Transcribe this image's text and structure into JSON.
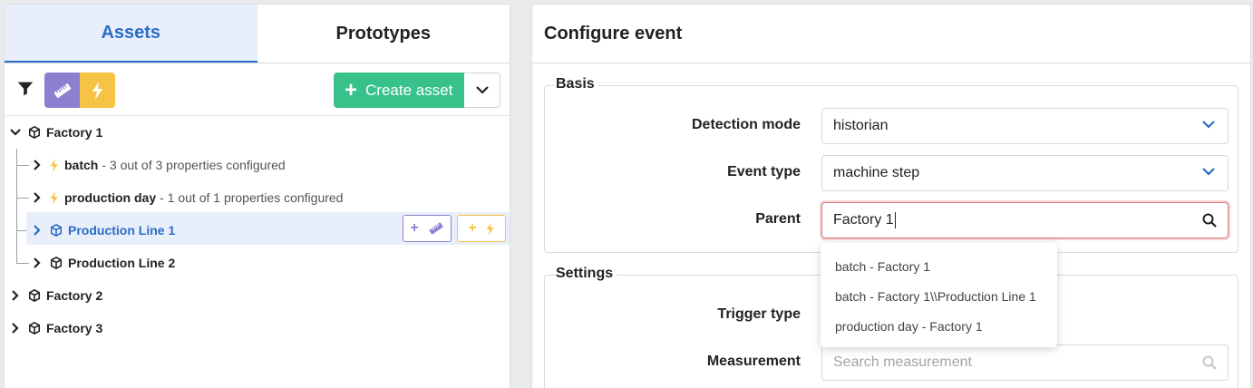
{
  "left_panel": {
    "tabs": [
      {
        "label": "Assets",
        "active": true
      },
      {
        "label": "Prototypes",
        "active": false
      }
    ],
    "toolbar": {
      "filter_icon": "filter-icon",
      "toggle_measurement_icon": "ruler-icon",
      "toggle_event_icon": "lightning-icon",
      "create_label": "Create asset",
      "create_color": "#38c28b"
    },
    "tree": [
      {
        "label": "Factory 1",
        "desc": "",
        "icon": "cube-icon",
        "expanded": true
      },
      {
        "label": "batch",
        "desc": "- 3 out of 3 properties configured",
        "icon": "lightning-icon"
      },
      {
        "label": "production day",
        "desc": "- 1 out of 1 properties configured",
        "icon": "lightning-icon"
      },
      {
        "label": "Production Line 1",
        "desc": "",
        "icon": "cube-icon",
        "selected": true
      },
      {
        "label": "Production Line 2",
        "desc": "",
        "icon": "cube-icon"
      },
      {
        "label": "Factory 2",
        "desc": "",
        "icon": "cube-icon"
      },
      {
        "label": "Factory 3",
        "desc": "",
        "icon": "cube-icon"
      }
    ],
    "row_actions": {
      "add_measurement": "+",
      "add_event": "+"
    }
  },
  "right_panel": {
    "title": "Configure event",
    "basis": {
      "legend": "Basis",
      "detection_mode": {
        "label": "Detection mode",
        "value": "historian"
      },
      "event_type": {
        "label": "Event type",
        "value": "machine step"
      },
      "parent": {
        "label": "Parent",
        "value": "Factory 1"
      }
    },
    "settings": {
      "legend": "Settings",
      "trigger_type": {
        "label": "Trigger type"
      },
      "measurement": {
        "label": "Measurement",
        "placeholder": "Search measurement"
      }
    },
    "parent_suggestions": [
      "batch - Factory 1",
      "batch - Factory 1\\\\Production Line 1",
      "production day - Factory 1"
    ]
  },
  "colors": {
    "accent_blue": "#2b6cc7",
    "measurement_purple": "#8d7fd0",
    "event_yellow": "#f6c344",
    "error_border": "#e07a7a"
  }
}
